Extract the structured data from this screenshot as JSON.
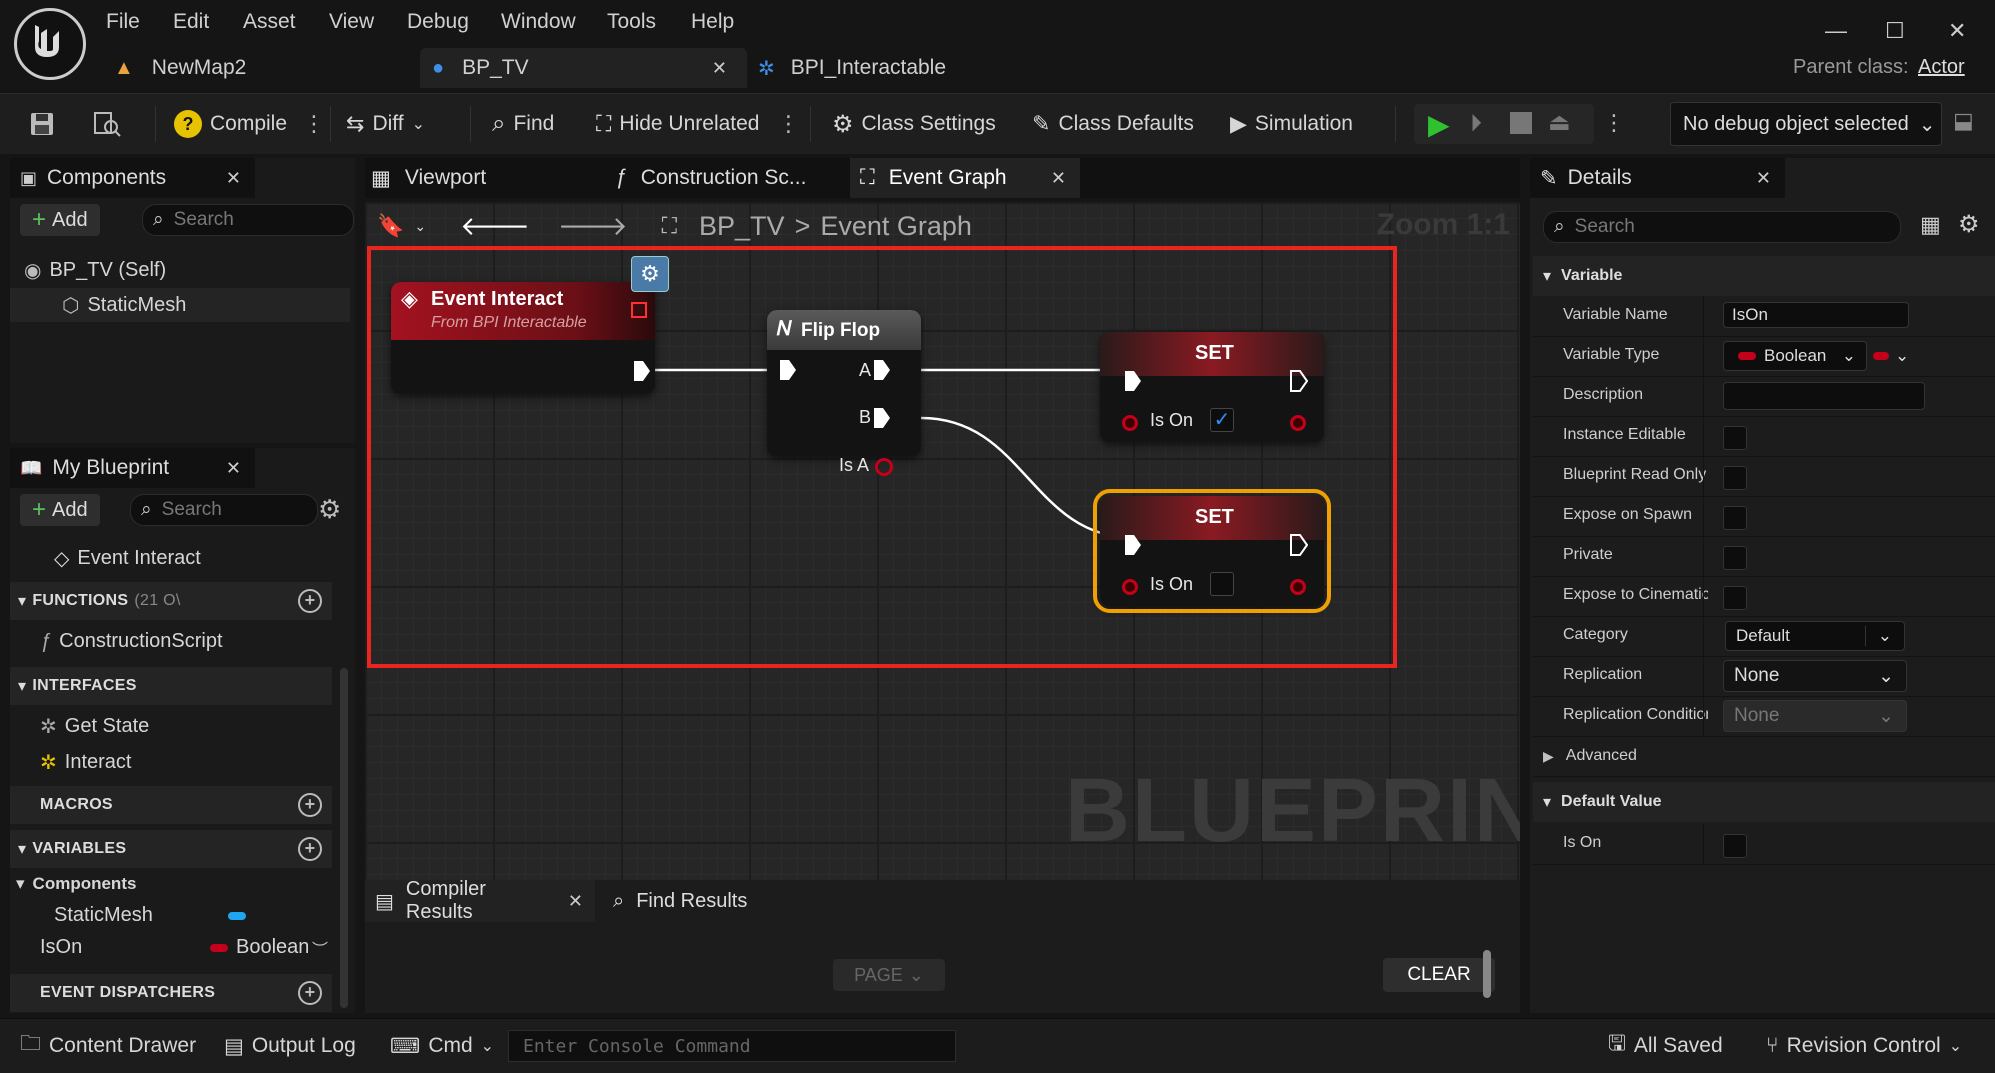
{
  "menu": [
    "File",
    "Edit",
    "Asset",
    "View",
    "Debug",
    "Window",
    "Tools",
    "Help"
  ],
  "tabs": [
    {
      "label": "NewMap2"
    },
    {
      "label": "BP_TV"
    },
    {
      "label": "BPI_Interactable"
    }
  ],
  "parent_class": {
    "label": "Parent class:",
    "value": "Actor"
  },
  "toolbar": {
    "compile": "Compile",
    "diff": "Diff",
    "find": "Find",
    "hide_unrelated": "Hide Unrelated",
    "class_settings": "Class Settings",
    "class_defaults": "Class Defaults",
    "simulation": "Simulation",
    "debug_object": "No debug object selected"
  },
  "components_panel": {
    "title": "Components",
    "add": "Add",
    "search_placeholder": "Search",
    "items": [
      {
        "label": "BP_TV (Self)"
      },
      {
        "label": "StaticMesh"
      }
    ]
  },
  "my_blueprint": {
    "title": "My Blueprint",
    "add": "Add",
    "search_placeholder": "Search",
    "event_item": "Event Interact",
    "functions": {
      "label": "FUNCTIONS",
      "count": "(21 O\\",
      "items": [
        "ConstructionScript"
      ]
    },
    "interfaces": {
      "label": "INTERFACES",
      "items": [
        "Get State",
        "Interact"
      ]
    },
    "macros": {
      "label": "MACROS"
    },
    "variables": {
      "label": "VARIABLES",
      "group": "Components",
      "items": [
        {
          "name": "StaticMesh",
          "type": ""
        },
        {
          "name": "IsOn",
          "type": "Boolean"
        }
      ]
    },
    "event_dispatchers": {
      "label": "EVENT DISPATCHERS"
    }
  },
  "graph_tabs": {
    "viewport": "Viewport",
    "construction": "Construction Sc...",
    "event_graph": "Event Graph"
  },
  "graph": {
    "breadcrumb": {
      "root": "BP_TV",
      "sep": ">",
      "current": "Event Graph"
    },
    "zoom": "Zoom 1:1",
    "watermark": "BLUEPRINT",
    "nodes": {
      "event": {
        "title": "Event Interact",
        "subtitle": "From BPI Interactable"
      },
      "flipflop": {
        "title": "Flip Flop",
        "pin_a": "A",
        "pin_b": "B",
        "pin_isa": "Is A"
      },
      "set1": {
        "title": "SET",
        "pin": "Is On",
        "value": true
      },
      "set2": {
        "title": "SET",
        "pin": "Is On",
        "value": false
      }
    }
  },
  "results": {
    "compiler": "Compiler Results",
    "find": "Find Results",
    "page": "PAGE",
    "clear": "CLEAR"
  },
  "details": {
    "title": "Details",
    "search_placeholder": "Search",
    "variable_section": "Variable",
    "variable_name": {
      "label": "Variable Name",
      "value": "IsOn"
    },
    "variable_type": {
      "label": "Variable Type",
      "value": "Boolean"
    },
    "description": {
      "label": "Description"
    },
    "instance_editable": {
      "label": "Instance Editable"
    },
    "bp_read_only": {
      "label": "Blueprint Read Only"
    },
    "expose_spawn": {
      "label": "Expose on Spawn"
    },
    "private": {
      "label": "Private"
    },
    "expose_cine": {
      "label": "Expose to Cinematics"
    },
    "category": {
      "label": "Category",
      "value": "Default"
    },
    "replication": {
      "label": "Replication",
      "value": "None"
    },
    "replication_cond": {
      "label": "Replication Condition",
      "value": "None"
    },
    "advanced": "Advanced",
    "default_section": "Default Value",
    "is_on": {
      "label": "Is On"
    }
  },
  "statusbar": {
    "content_drawer": "Content Drawer",
    "output_log": "Output Log",
    "cmd": "Cmd",
    "console_placeholder": "Enter Console Command",
    "all_saved": "All Saved",
    "revision": "Revision Control"
  },
  "colors": {
    "bool_red": "#c4001a",
    "accent_blue": "#1ea6f0",
    "selection_red": "#e8261f",
    "selected_orange": "#f0a000",
    "play_green": "#2fc12f"
  }
}
